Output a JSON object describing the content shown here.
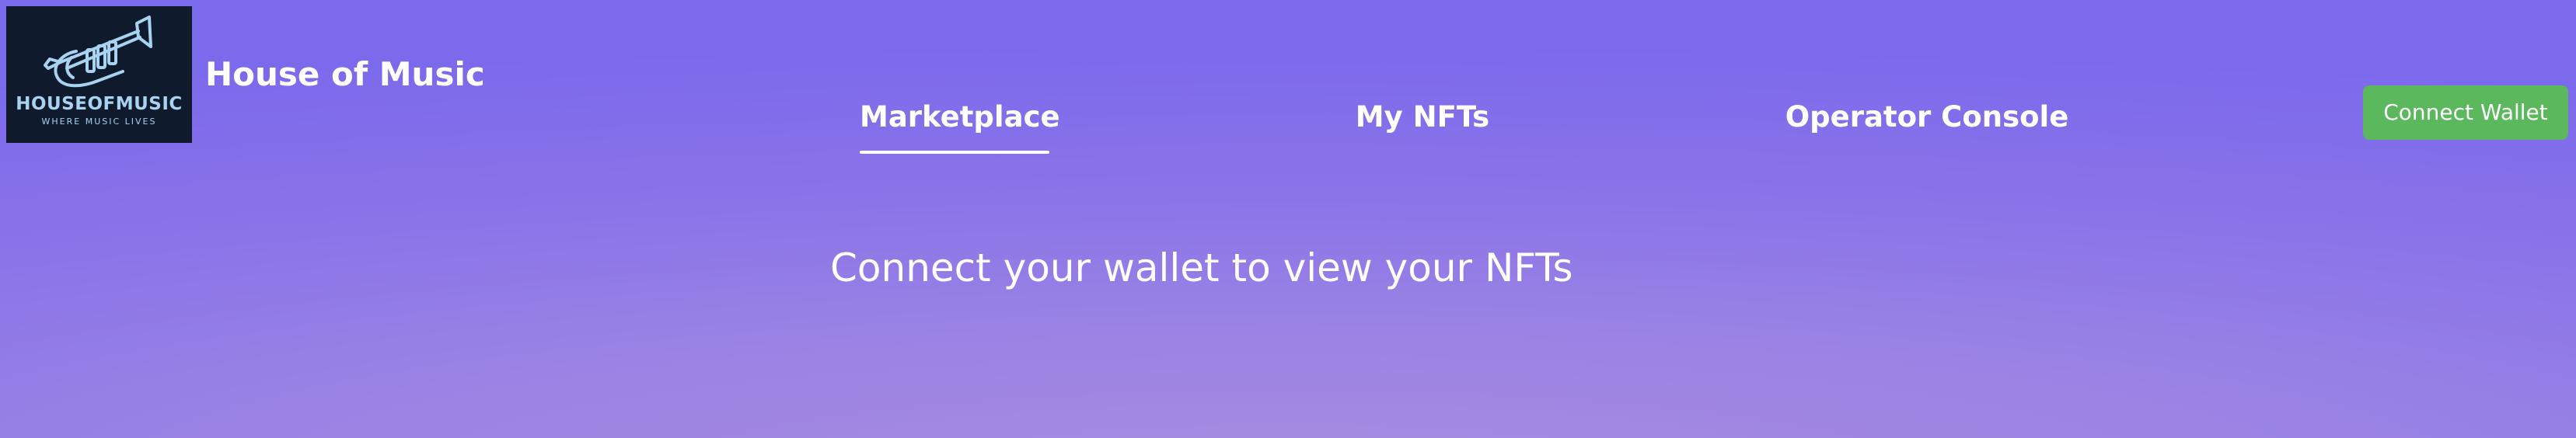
{
  "brand": {
    "title": "House of Music",
    "logo_wordmark": "HOUSEOFMUSIC",
    "logo_tagline": "WHERE MUSIC LIVES",
    "logo_bg_color": "#0f1a2c",
    "logo_accent_color": "#a7d3f0",
    "logo_icon": "trumpet-icon"
  },
  "nav": {
    "tabs": [
      {
        "label": "Marketplace",
        "active": true
      },
      {
        "label": "My NFTs",
        "active": false
      },
      {
        "label": "Operator Console",
        "active": false
      }
    ]
  },
  "header": {
    "connect_wallet_label": "Connect Wallet",
    "connect_wallet_color": "#5cb85c"
  },
  "main": {
    "message": "Connect your wallet to view your NFTs"
  },
  "colors": {
    "background_top": "#7c6aec",
    "background_bottom": "#a88ce0",
    "text": "#ffffff"
  }
}
